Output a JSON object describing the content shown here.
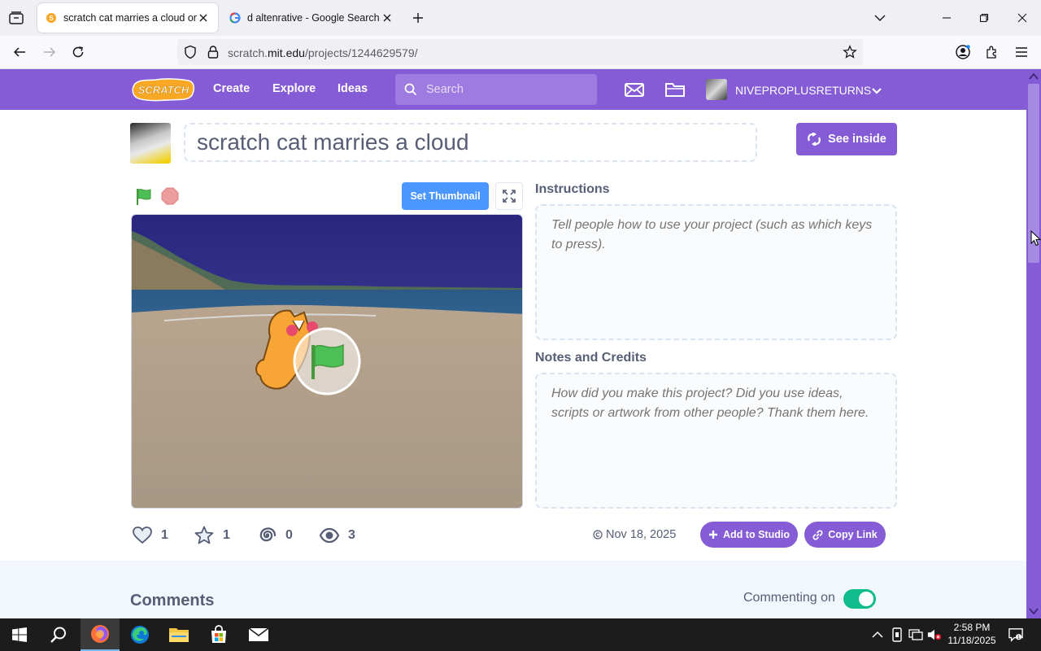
{
  "browser": {
    "tabs": [
      {
        "title": "scratch cat marries a cloud on S",
        "active": true
      },
      {
        "title": "d altenrative - Google Search",
        "active": false
      }
    ],
    "url_host": "scratch.mit.edu",
    "url_prefix": "scratch.",
    "url_domain": "mit.edu",
    "url_path": "/projects/1244629579/"
  },
  "header": {
    "nav": [
      "Create",
      "Explore",
      "Ideas"
    ],
    "search_placeholder": "Search",
    "username": "NIVEPROPLUSRETURNS"
  },
  "project": {
    "title": "scratch cat marries a cloud",
    "see_inside_label": "See inside",
    "set_thumbnail_label": "Set Thumbnail",
    "instructions_heading": "Instructions",
    "instructions_placeholder": "Tell people how to use your project (such as which keys to press).",
    "notes_heading": "Notes and Credits",
    "notes_placeholder": "How did you make this project? Did you use ideas, scripts or artwork from other people? Thank them here.",
    "stats": {
      "loves": "1",
      "favorites": "1",
      "remixes": "0",
      "views": "3"
    },
    "date": "Nov 18, 2025",
    "add_to_studio_label": "Add to Studio",
    "copy_link_label": "Copy Link"
  },
  "comments": {
    "heading": "Comments",
    "commenting_label": "Commenting on",
    "commenting_enabled": true
  },
  "taskbar": {
    "time": "2:58 PM",
    "date": "11/18/2025"
  },
  "colors": {
    "scratch_purple": "#855cd6",
    "scratch_blue": "#4c97ff",
    "toggle_green": "#0fbd8c"
  }
}
